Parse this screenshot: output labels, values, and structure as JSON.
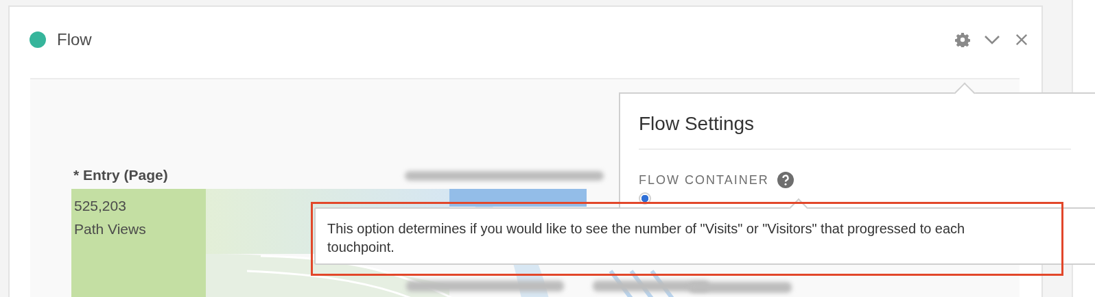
{
  "panel": {
    "title": "Flow"
  },
  "chart": {
    "entry_header": "* Entry (Page)",
    "entry_value": "525,203",
    "entry_label": "Path Views"
  },
  "settings": {
    "title": "Flow Settings",
    "section": "FLOW CONTAINER",
    "options": [
      {
        "selected": true
      }
    ]
  },
  "tooltip": {
    "text": "This option determines if you would like to see the number of \"Visits\" or \"Visitors\" that progressed to each touchpoint."
  }
}
